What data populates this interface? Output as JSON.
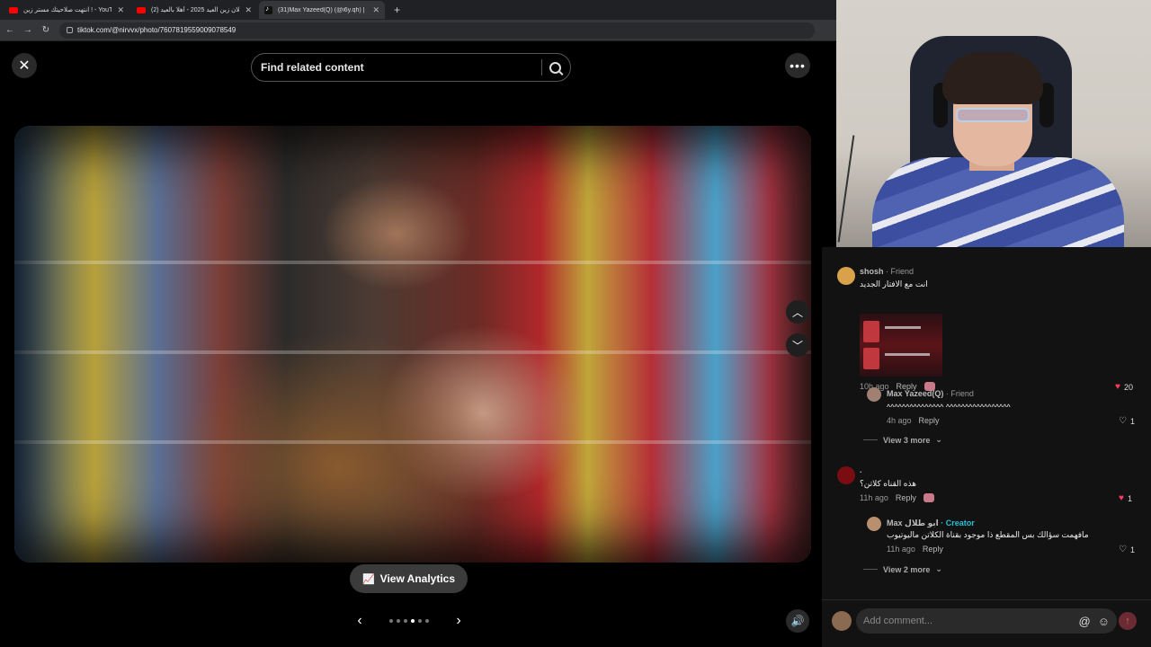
{
  "browser": {
    "tabs": [
      {
        "label": "انتهت صلاحيتك مستر زين ! - YouTube",
        "icon": "youtube-icon"
      },
      {
        "label": "(2) إعلان زين العيد 2025 - أهلا بالعيد",
        "icon": "youtube-icon"
      },
      {
        "label": "(31)Max Yazeed(Q) (@i6y.qh) |",
        "icon": "tiktok-icon"
      }
    ],
    "url": "tiktok.com/@nirvvx/photo/7607819559009078549"
  },
  "viewer": {
    "search_placeholder": "Find related content",
    "analytics_label": "View Analytics",
    "carousel_dots": 6,
    "carousel_active_index": 3
  },
  "comments": [
    {
      "name": "shosh",
      "tag": "· Friend",
      "text": "انت مع الافتار الجديد",
      "time": "10h ago",
      "reply_label": "Reply",
      "likes": "20",
      "liked": true,
      "replies": [
        {
          "name": "Max Yazeed(Q)",
          "tag": "· Friend",
          "text": "^^^^^^^^^^^^^^^ ^^^^^^^^^^^^^^^^^",
          "time": "4h ago",
          "reply_label": "Reply",
          "likes": "1",
          "liked": false
        }
      ],
      "view_more": "View 3 more"
    },
    {
      "name": ".",
      "tag": "",
      "text": "هذه القناه كلاتن؟",
      "time": "11h ago",
      "reply_label": "Reply",
      "likes": "1",
      "liked": true,
      "replies": [
        {
          "name": "Max ابو طلال",
          "tag": "· Creator",
          "text": "مافهمت سؤالك بس المقطع ذا موجود بقناة الكلاتن ماليوتيوب",
          "time": "11h ago",
          "reply_label": "Reply",
          "likes": "1",
          "liked": false
        }
      ],
      "view_more": "View 2 more"
    }
  ],
  "composer": {
    "placeholder": "Add comment..."
  },
  "colors": {
    "accent": "#fe2c55",
    "creator": "#25c2d6",
    "panel": "#121212"
  }
}
